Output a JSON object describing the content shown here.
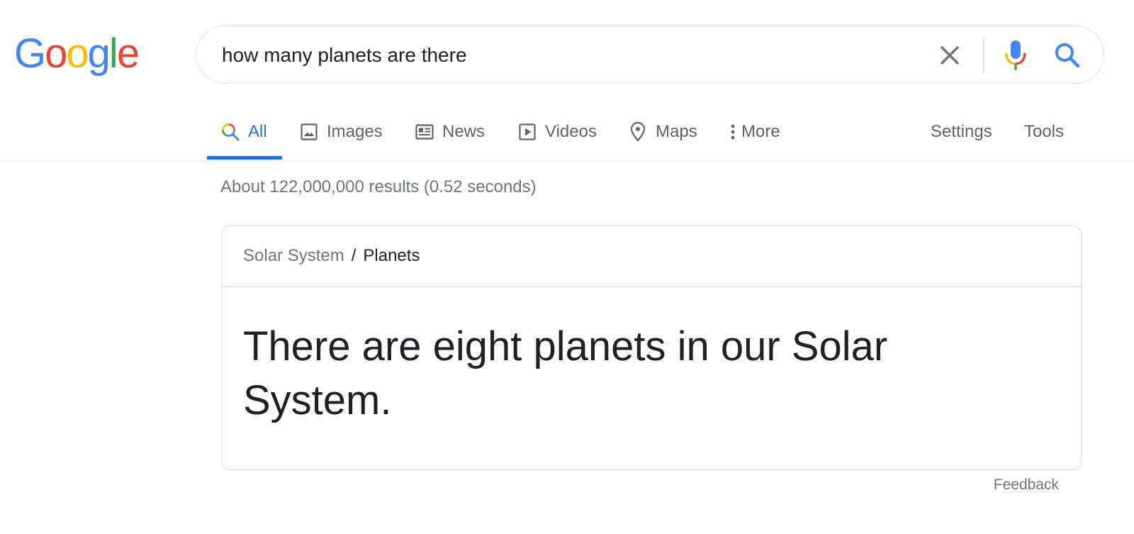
{
  "logo": {
    "letters": [
      "G",
      "o",
      "o",
      "g",
      "l",
      "e"
    ],
    "colors": [
      "#4285F4",
      "#EA4335",
      "#FBBC05",
      "#4285F4",
      "#34A853",
      "#EA4335"
    ]
  },
  "search": {
    "query": "how many planets are there",
    "clear_icon": "close-icon",
    "mic_icon": "microphone-icon",
    "search_icon": "search-icon"
  },
  "tabs": [
    {
      "label": "All",
      "icon": "search-icon",
      "active": true
    },
    {
      "label": "Images",
      "icon": "image-icon",
      "active": false
    },
    {
      "label": "News",
      "icon": "newspaper-icon",
      "active": false
    },
    {
      "label": "Videos",
      "icon": "play-icon",
      "active": false
    },
    {
      "label": "Maps",
      "icon": "map-pin-icon",
      "active": false
    },
    {
      "label": "More",
      "icon": "vertical-dots-icon",
      "active": false
    }
  ],
  "tools": {
    "settings_label": "Settings",
    "tools_label": "Tools"
  },
  "results": {
    "stats": "About 122,000,000 results (0.52 seconds)"
  },
  "answer_card": {
    "breadcrumb_parent": "Solar System",
    "breadcrumb_separator": "/",
    "breadcrumb_current": "Planets",
    "answer": "There are eight planets in our Solar System."
  },
  "feedback_label": "Feedback",
  "colors": {
    "accent": "#1a73e8",
    "muted_text": "#70757a",
    "tab_text": "#5f6368",
    "border": "#dfe1e5"
  }
}
